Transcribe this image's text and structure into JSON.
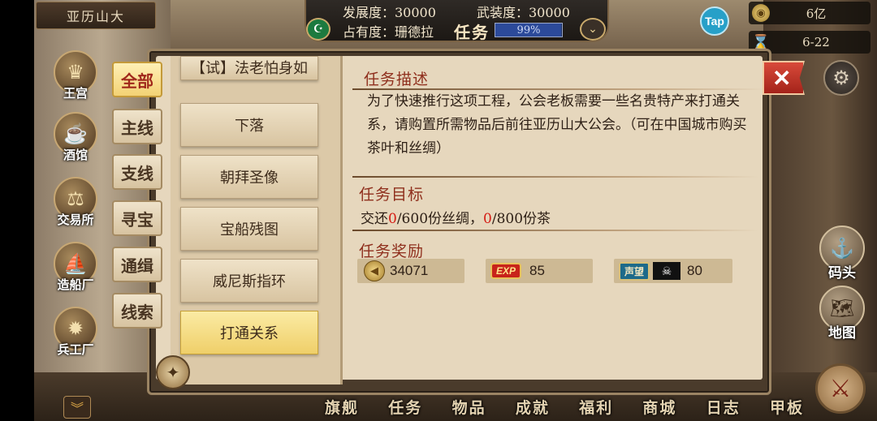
{
  "hud": {
    "city_name": "亚历山大",
    "development": "发展度：30000",
    "military": "武装度：30000",
    "occupancy": "占有度：珊德拉",
    "panel_title": "任务",
    "occupancy_percent_label": "99%",
    "occupancy_percent": 99,
    "tap_label": "Tap",
    "gold": "6亿",
    "date": "6-22"
  },
  "left_buildings": [
    {
      "label": "王宫",
      "icon": "crown-icon"
    },
    {
      "label": "酒馆",
      "icon": "beer-icon"
    },
    {
      "label": "交易所",
      "icon": "scale-icon"
    },
    {
      "label": "造船厂",
      "icon": "ship-icon"
    },
    {
      "label": "兵工厂",
      "icon": "cannon-icon"
    }
  ],
  "category_tabs": [
    {
      "label": "全部",
      "active": true
    },
    {
      "label": "主线",
      "active": false
    },
    {
      "label": "支线",
      "active": false
    },
    {
      "label": "寻宝",
      "active": false
    },
    {
      "label": "通缉",
      "active": false
    },
    {
      "label": "线索",
      "active": false
    }
  ],
  "quest_list": [
    {
      "label": "【试】法老怕身如",
      "partial": true
    },
    {
      "label": "下落"
    },
    {
      "label": "朝拜圣像"
    },
    {
      "label": "宝船残图"
    },
    {
      "label": "威尼斯指环"
    },
    {
      "label": "打通关系",
      "selected": true
    }
  ],
  "detail": {
    "desc_title": "任务描述",
    "description": "为了快速推行这项工程，公会老板需要一些名贵特产来打通关系，请购置所需物品后前往亚历山大公会。（可在中国城市购买茶叶和丝绸）",
    "goal_title": "任务目标",
    "goal": {
      "prefix": "交还",
      "silk_have": "0",
      "silk_rest": "/600份丝绸，",
      "tea_have": "0",
      "tea_rest": "/800份茶"
    },
    "reward_title": "任务奖励",
    "rewards": {
      "gold": "34071",
      "exp_badge": "EXP",
      "exp": "85",
      "reputation_badge": "声望",
      "reputation": "80"
    }
  },
  "right_buttons": [
    {
      "label": "码头",
      "icon": "dock-icon"
    },
    {
      "label": "地图",
      "icon": "map-icon"
    }
  ],
  "bottom_nav": [
    "旗舰",
    "任务",
    "物品",
    "成就",
    "福利",
    "商城",
    "日志",
    "甲板"
  ],
  "colors": {
    "accent_red": "#8f2f1d",
    "highlight_yellow": "#f3d274",
    "goal_red": "#d51c14"
  }
}
